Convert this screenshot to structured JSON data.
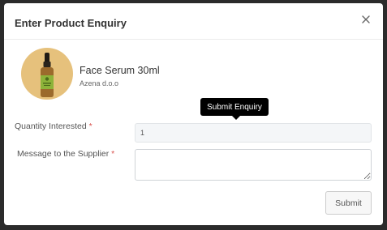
{
  "modal": {
    "title": "Enter Product Enquiry",
    "close_icon": "close-icon"
  },
  "product": {
    "name": "Face Serum 30ml",
    "seller": "Azena d.o.o",
    "image_icon": "serum-bottle-icon"
  },
  "form": {
    "quantity": {
      "label": "Quantity Interested",
      "required_mark": "*",
      "value": "1"
    },
    "message": {
      "label": "Message to the Supplier",
      "required_mark": "*",
      "value": ""
    },
    "submit_label": "Submit"
  },
  "tooltip": {
    "text": "Submit Enquiry"
  },
  "colors": {
    "thumb_background": "#e6c17c",
    "bottle_body": "#9b6a2c",
    "bottle_label": "#8db33a",
    "required": "#d9534f"
  }
}
